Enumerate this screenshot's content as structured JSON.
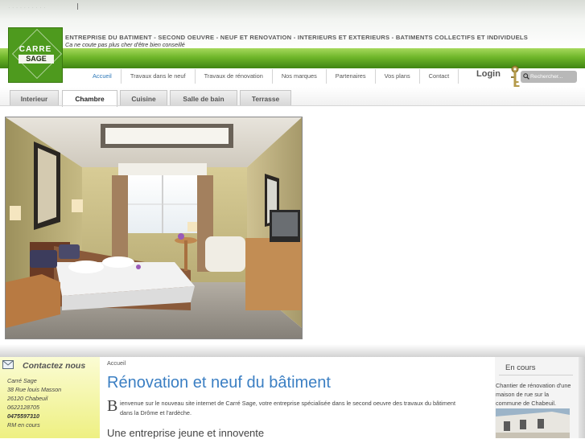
{
  "brand": {
    "logo_line1": "CARRE",
    "logo_line2": "SAGE",
    "headline": "ENTREPRISE DU BATIMENT - SECOND OEUVRE - NEUF ET RENOVATION - INTERIEURS ET EXTERIEURS - BATIMENTS COLLECTIFS ET INDIVIDUELS",
    "slogan": "Ca ne coute pas plus cher d'être bien conseillé"
  },
  "nav": {
    "items": [
      {
        "label": "Accueil",
        "active": true
      },
      {
        "label": "Travaux dans le neuf"
      },
      {
        "label": "Travaux de rénovation"
      },
      {
        "label": "Nos marques"
      },
      {
        "label": "Partenaires"
      },
      {
        "label": "Vos plans"
      },
      {
        "label": "Contact"
      }
    ],
    "login_label": "Login",
    "search_placeholder": "Rechercher...",
    "search_icon": "search-icon",
    "keys_icon": "keys-icon"
  },
  "tabs": [
    {
      "label": "Interieur"
    },
    {
      "label": "Chambre",
      "active": true
    },
    {
      "label": "Cuisine"
    },
    {
      "label": "Salle de bain"
    },
    {
      "label": "Terrasse"
    }
  ],
  "contact": {
    "icon": "mail-icon",
    "title": "Contactez nous",
    "lines": [
      "Carré Sage",
      "38 Rue louis Masson",
      "26120 Chabeuil",
      "0622128705",
      "0475597310",
      "RM en cours"
    ]
  },
  "main": {
    "breadcrumb": "Accueil",
    "title": "Rénovation et neuf du bâtiment",
    "dropcap": "B",
    "welcome_line1": "ienvenue sur le nouveau site internet de Carré Sage, votre entreprise spécialisée dans le second oeuvre des travaux du bâtiment",
    "welcome_line2": "dans la Drôme et l'ardèche.",
    "subtitle": "Une entreprise jeune et innovente"
  },
  "sidebar_right": {
    "title": "En cours",
    "text_lines": [
      "Chantier de rénovation d'une",
      "maison de rue sur la",
      "commune de Chabeuil."
    ]
  },
  "colors": {
    "green_band": "#6fb62a",
    "logo_green": "#4e9a1e",
    "title_blue": "#3b7fc3",
    "nav_active": "#2e78b8",
    "contact_bg": "#eef082"
  }
}
